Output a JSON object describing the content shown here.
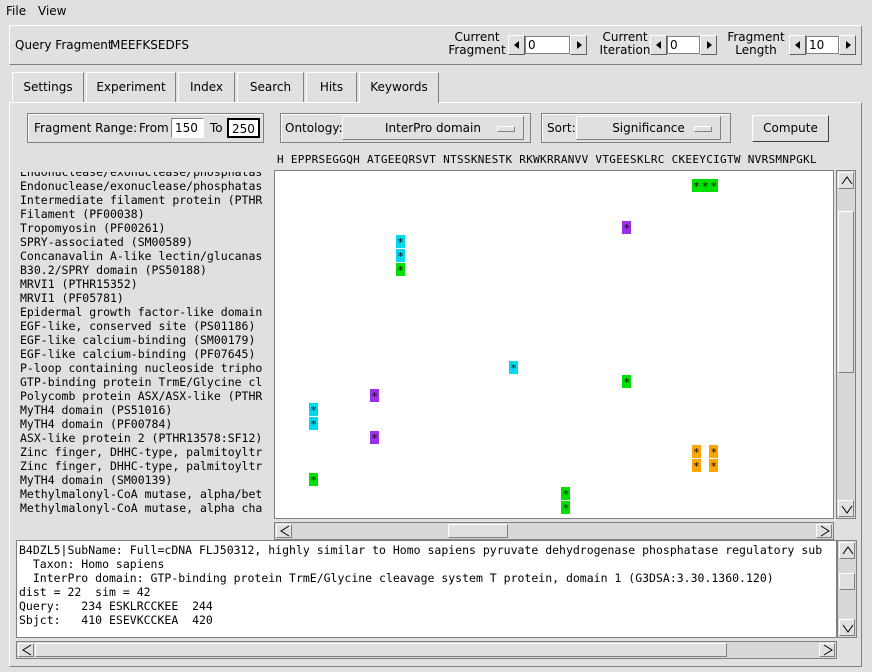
{
  "menu": {
    "file": "File",
    "view": "View"
  },
  "header": {
    "query_label": "Query Fragment",
    "query_value": "MEEFKSEDFS",
    "current_fragment_label_1": "Current",
    "current_fragment_label_2": "Fragment",
    "current_fragment_value": "0",
    "current_iteration_label_1": "Current",
    "current_iteration_label_2": "Iteration",
    "current_iteration_value": "0",
    "fragment_length_label_1": "Fragment",
    "fragment_length_label_2": "Length",
    "fragment_length_value": "10"
  },
  "tabs": [
    "Settings",
    "Experiment",
    "Index",
    "Search",
    "Hits",
    "Keywords"
  ],
  "active_tab": "Keywords",
  "controls": {
    "fragment_range_label": "Fragment Range:",
    "from_label": "From",
    "from_value": "150",
    "to_label": "To",
    "to_value": "250",
    "ontology_label": "Ontology:",
    "ontology_value": "InterPro domain",
    "sort_label": "Sort:",
    "sort_value": "Significance",
    "compute_label": "Compute"
  },
  "sequence_header": "H EPPRSEGGQH ATGEEQRSVT NTSSKNESTK RKWKRRANVV VTGEESKLRC CKEEYCIGTW NVRSMNPGKL",
  "rows": [
    {
      "label": "Endonuclease/exonuclease/phosphatas",
      "marks": []
    },
    {
      "label": "Endonuclease/exonuclease/phosphatas",
      "marks": [
        {
          "col": 47,
          "color": "#00e000",
          "text": "*"
        },
        {
          "col": 48,
          "color": "#00e000",
          "text": "*"
        },
        {
          "col": 49,
          "color": "#00e000",
          "text": "*"
        }
      ]
    },
    {
      "label": "Intermediate filament protein (PTHR",
      "marks": []
    },
    {
      "label": "Filament (PF00038)",
      "marks": []
    },
    {
      "label": "Tropomyosin (PF00261)",
      "marks": [
        {
          "col": 39,
          "color": "#9b30e8",
          "text": "*"
        }
      ]
    },
    {
      "label": "SPRY-associated (SM00589)",
      "marks": [
        {
          "col": 13,
          "color": "#00d8f0",
          "text": "*"
        }
      ]
    },
    {
      "label": "Concanavalin A-like lectin/glucanas",
      "marks": [
        {
          "col": 13,
          "color": "#00d8f0",
          "text": "*"
        }
      ]
    },
    {
      "label": "B30.2/SPRY domain (PS50188)",
      "marks": [
        {
          "col": 13,
          "color": "#00e000",
          "text": "*"
        }
      ]
    },
    {
      "label": "MRVI1 (PTHR15352)",
      "marks": []
    },
    {
      "label": "MRVI1 (PF05781)",
      "marks": []
    },
    {
      "label": "Epidermal growth factor-like domain",
      "marks": []
    },
    {
      "label": "EGF-like, conserved site (PS01186)",
      "marks": []
    },
    {
      "label": "EGF-like calcium-binding (SM00179)",
      "marks": []
    },
    {
      "label": "EGF-like calcium-binding (PF07645)",
      "marks": []
    },
    {
      "label": "P-loop containing nucleoside tripho",
      "marks": [
        {
          "col": 26,
          "color": "#00d8f0",
          "text": "*"
        }
      ]
    },
    {
      "label": "GTP-binding protein TrmE/Glycine cl",
      "marks": [
        {
          "col": 39,
          "color": "#00e000",
          "text": "*"
        }
      ]
    },
    {
      "label": "Polycomb protein ASX/ASX-like (PTHR",
      "marks": [
        {
          "col": 10,
          "color": "#9b30e8",
          "text": "*"
        }
      ]
    },
    {
      "label": "MyTH4 domain (PS51016)",
      "marks": [
        {
          "col": 3,
          "color": "#00d8f0",
          "text": "*"
        }
      ]
    },
    {
      "label": "MyTH4 domain (PF00784)",
      "marks": [
        {
          "col": 3,
          "color": "#00d8f0",
          "text": "*"
        }
      ]
    },
    {
      "label": "ASX-like protein 2 (PTHR13578:SF12)",
      "marks": [
        {
          "col": 10,
          "color": "#9b30e8",
          "text": "*"
        }
      ]
    },
    {
      "label": "Zinc finger, DHHC-type, palmitoyltr",
      "marks": [
        {
          "col": 47,
          "color": "#ffa500",
          "text": "*"
        },
        {
          "col": 49,
          "color": "#ffa500",
          "text": "*"
        }
      ]
    },
    {
      "label": "Zinc finger, DHHC-type, palmitoyltr",
      "marks": [
        {
          "col": 47,
          "color": "#ffa500",
          "text": "*"
        },
        {
          "col": 49,
          "color": "#ffa500",
          "text": "*"
        }
      ]
    },
    {
      "label": "MyTH4 domain (SM00139)",
      "marks": [
        {
          "col": 3,
          "color": "#00e000",
          "text": "*"
        }
      ]
    },
    {
      "label": "Methylmalonyl-CoA mutase, alpha/bet",
      "marks": [
        {
          "col": 32,
          "color": "#00e000",
          "text": "*"
        }
      ]
    },
    {
      "label": "Methylmalonyl-CoA mutase, alpha cha",
      "marks": [
        {
          "col": 32,
          "color": "#00e000",
          "text": "*"
        }
      ]
    }
  ],
  "detail": [
    "B4DZL5|SubName: Full=cDNA FLJ50312, highly similar to Homo sapiens pyruvate dehydrogenase phosphatase regulatory sub",
    "  Taxon: Homo sapiens",
    "  InterPro domain: GTP-binding protein TrmE/Glycine cleavage system T protein, domain 1 (G3DSA:3.30.1360.120)",
    "dist = 22  sim = 42",
    "Query:   234 ESKLRCCKEE  244",
    "Sbjct:   410 ESEVKCCKEA  420"
  ]
}
